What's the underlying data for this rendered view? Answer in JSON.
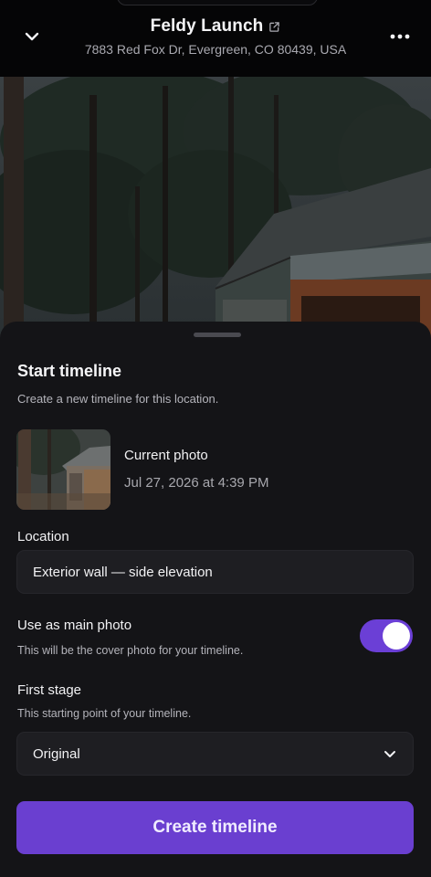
{
  "header": {
    "title": "Feldy Launch",
    "address": "7883 Red Fox Dr, Evergreen, CO 80439, USA",
    "back_icon": "chevron-down-icon",
    "link_icon": "external-link-icon",
    "more_icon": "more-horizontal-icon"
  },
  "sheet": {
    "title": "Start timeline",
    "subtitle": "Create a new timeline for this location.",
    "current_photo": {
      "label": "Current photo",
      "date": "Jul 27, 2026 at 4:39 PM"
    },
    "location": {
      "label": "Location",
      "value": "Exterior wall — side elevation"
    },
    "main_photo": {
      "label": "Use as main photo",
      "description": "This will be the cover photo for your timeline.",
      "enabled": true
    },
    "first_stage": {
      "label": "First stage",
      "description": "This starting point of your timeline.",
      "selected": "Original"
    },
    "create_button": "Create timeline"
  },
  "colors": {
    "accent": "#6a3fd0",
    "background": "#0b0b0d",
    "sheet": "#141417",
    "field": "#1e1e22"
  }
}
